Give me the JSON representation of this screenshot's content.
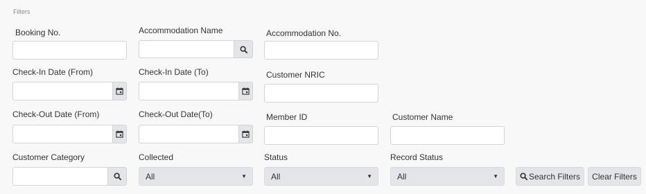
{
  "panel": {
    "title": "Filters"
  },
  "fields": {
    "booking_no": {
      "label": "Booking No.",
      "value": ""
    },
    "accommodation_name": {
      "label": "Accommodation Name",
      "value": ""
    },
    "accommodation_no": {
      "label": "Accommodation No.",
      "value": ""
    },
    "checkin_from": {
      "label": "Check-In Date (From)",
      "value": ""
    },
    "checkin_to": {
      "label": "Check-In Date (To)",
      "value": ""
    },
    "customer_nric": {
      "label": "Customer NRIC",
      "value": ""
    },
    "checkout_from": {
      "label": "Check-Out Date (From)",
      "value": ""
    },
    "checkout_to": {
      "label": "Check-Out Date(To)",
      "value": ""
    },
    "member_id": {
      "label": "Member ID",
      "value": ""
    },
    "customer_name": {
      "label": "Customer Name",
      "value": ""
    },
    "customer_category": {
      "label": "Customer Category",
      "value": ""
    },
    "collected": {
      "label": "Collected",
      "selected": "All"
    },
    "status": {
      "label": "Status",
      "selected": "All"
    },
    "record_status": {
      "label": "Record Status",
      "selected": "All"
    }
  },
  "buttons": {
    "search_filters": "Search Filters",
    "clear_filters": "Clear Filters"
  },
  "icons": {
    "search": "search-icon",
    "calendar": "calendar-icon",
    "dropdown": "caret-down-icon"
  },
  "colors": {
    "background": "#f8f8f8",
    "addon": "#e3e5e8",
    "border": "#d4d4d4"
  }
}
